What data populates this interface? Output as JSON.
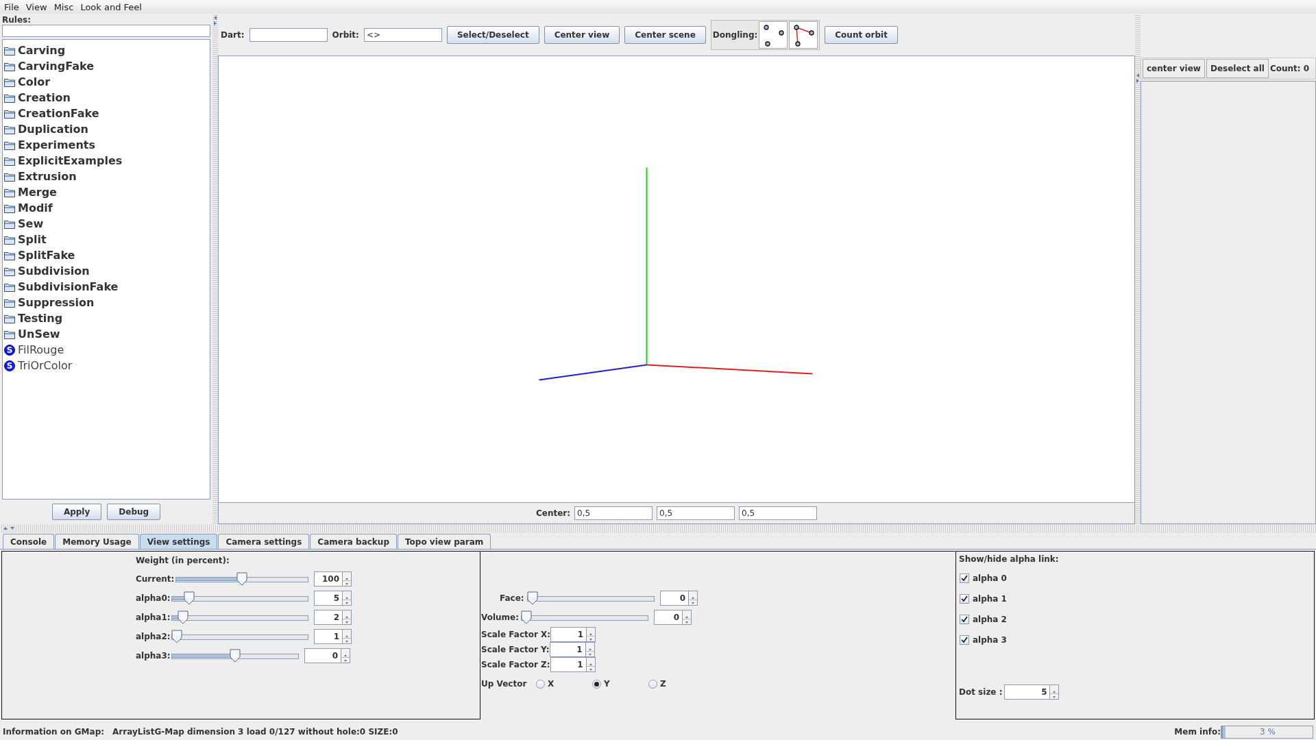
{
  "menu": [
    {
      "label": "File"
    },
    {
      "label": "View"
    },
    {
      "label": "Misc"
    },
    {
      "label": "Look and Feel"
    }
  ],
  "rules": {
    "label": "Rules:",
    "items": [
      {
        "kind": "folder",
        "label": "Carving"
      },
      {
        "kind": "folder",
        "label": "CarvingFake"
      },
      {
        "kind": "folder",
        "label": "Color"
      },
      {
        "kind": "folder",
        "label": "Creation"
      },
      {
        "kind": "folder",
        "label": "CreationFake"
      },
      {
        "kind": "folder",
        "label": "Duplication"
      },
      {
        "kind": "folder",
        "label": "Experiments"
      },
      {
        "kind": "folder",
        "label": "ExplicitExamples"
      },
      {
        "kind": "folder",
        "label": "Extrusion"
      },
      {
        "kind": "folder",
        "label": "Merge"
      },
      {
        "kind": "folder",
        "label": "Modif"
      },
      {
        "kind": "folder",
        "label": "Sew"
      },
      {
        "kind": "folder",
        "label": "Split"
      },
      {
        "kind": "folder",
        "label": "SplitFake"
      },
      {
        "kind": "folder",
        "label": "Subdivision"
      },
      {
        "kind": "folder",
        "label": "SubdivisionFake"
      },
      {
        "kind": "folder",
        "label": "Suppression"
      },
      {
        "kind": "folder",
        "label": "Testing"
      },
      {
        "kind": "folder",
        "label": "UnSew"
      },
      {
        "kind": "script",
        "badge": "S",
        "label": "FilRouge"
      },
      {
        "kind": "script",
        "badge": "S",
        "label": "TriOrColor"
      }
    ],
    "buttons": [
      "Apply",
      "Debug"
    ]
  },
  "toolbar": {
    "dart_label": "Dart:",
    "orbit_label": "Orbit:",
    "orbit_value": "<>",
    "buttons": [
      "Select/Deselect",
      "Center view",
      "Center scene"
    ],
    "dongling_label": "Dongling:",
    "count_button": "Count orbit"
  },
  "center": {
    "label": "Center:",
    "values": [
      "0,5",
      "0,5",
      "0,5"
    ]
  },
  "selection": {
    "buttons": [
      "center view",
      "Deselect all"
    ],
    "count": "Count: 0"
  },
  "tabs": [
    {
      "label": "Console",
      "selected": false
    },
    {
      "label": "Memory Usage",
      "selected": false
    },
    {
      "label": "View settings",
      "selected": true
    },
    {
      "label": "Camera settings",
      "selected": false
    },
    {
      "label": "Camera backup",
      "selected": false
    },
    {
      "label": "Topo view param",
      "selected": false
    }
  ],
  "weights": {
    "title": "Weight (in percent):",
    "rows": [
      {
        "label": "Current:",
        "level": 0.5,
        "value": "100"
      },
      {
        "label": "alpha0:",
        "level": 0.1,
        "value": "5"
      },
      {
        "label": "alpha1:",
        "level": 0.05,
        "value": "2"
      },
      {
        "label": "alpha2:",
        "level": 0,
        "value": "1"
      },
      {
        "label": "alpha3:",
        "level": 0.5,
        "value": "0"
      }
    ]
  },
  "view": {
    "sliders": [
      {
        "label": "Face:",
        "level": 0,
        "value": "0"
      },
      {
        "label": "Volume:",
        "level": 0,
        "value": "0"
      }
    ],
    "scale": [
      {
        "label": "Scale Factor X:",
        "value": "1"
      },
      {
        "label": "Scale Factor Y:",
        "value": "1"
      },
      {
        "label": "Scale Factor Z:",
        "value": "1"
      }
    ],
    "up_vector": {
      "label": "Up Vector",
      "options": [
        {
          "label": "X",
          "selected": false
        },
        {
          "label": "Y",
          "selected": true
        },
        {
          "label": "Z",
          "selected": false
        }
      ]
    }
  },
  "alpha_links": {
    "title": "Show/hide alpha link:",
    "items": [
      {
        "label": "alpha 0",
        "checked": true
      },
      {
        "label": "alpha 1",
        "checked": true
      },
      {
        "label": "alpha 2",
        "checked": true
      },
      {
        "label": "alpha 3",
        "checked": true
      }
    ],
    "dot_size_label": "Dot size :",
    "dot_size": "5"
  },
  "status": {
    "label": "Information on GMap:",
    "text": "ArrayListG-Map dimension 3 load 0/127 without hole:0 SIZE:0"
  },
  "memory": {
    "label": "Mem info:",
    "level": 0.03,
    "reading": "3 %"
  }
}
